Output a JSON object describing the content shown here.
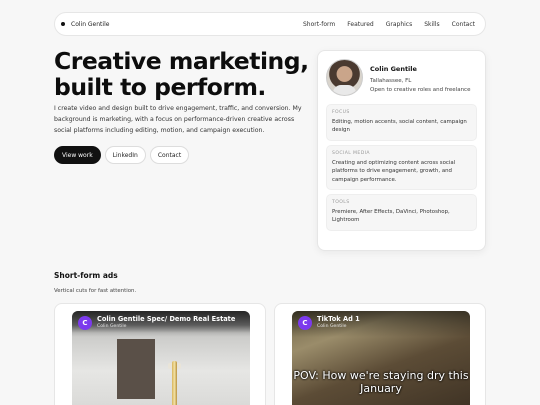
{
  "nav": {
    "brand": "Colin Gentile",
    "links": [
      "Short-form",
      "Featured",
      "Graphics",
      "Skills",
      "Contact"
    ]
  },
  "hero": {
    "title_line1": "Creative marketing,",
    "title_line2": "built to perform.",
    "description": "I create video and design built to drive engagement, traffic, and conversion. My background is marketing, with a focus on performance-driven creative across social platforms including editing, motion, and campaign execution.",
    "buttons": {
      "primary": "View work",
      "secondary1": "LinkedIn",
      "secondary2": "Contact"
    }
  },
  "profile": {
    "name": "Colin Gentile",
    "location": "Tallahassee, FL",
    "status": "Open to creative roles and freelance",
    "sections": [
      {
        "label": "FOCUS",
        "text": "Editing, motion accents, social content, campaign design"
      },
      {
        "label": "SOCIAL MEDIA",
        "text": "Creating and optimizing content across social platforms to drive engagement, growth, and campaign performance."
      },
      {
        "label": "TOOLS",
        "text": "Premiere, After Effects, DaVinci, Photoshop, Lightroom"
      }
    ]
  },
  "shortform": {
    "title": "Short-form ads",
    "subtitle": "Vertical cuts for fast attention.",
    "videos": [
      {
        "logo": "C",
        "title": "Colin Gentile Spec/ Demo Real Estate",
        "channel": "Colin Gentile",
        "caption": ""
      },
      {
        "logo": "C",
        "title": "TikTok Ad 1",
        "channel": "Colin Gentile",
        "caption": "POV: How we're staying dry this January"
      }
    ]
  },
  "colors": {
    "accent": "#111111",
    "channel_logo": "#7c3aed"
  }
}
